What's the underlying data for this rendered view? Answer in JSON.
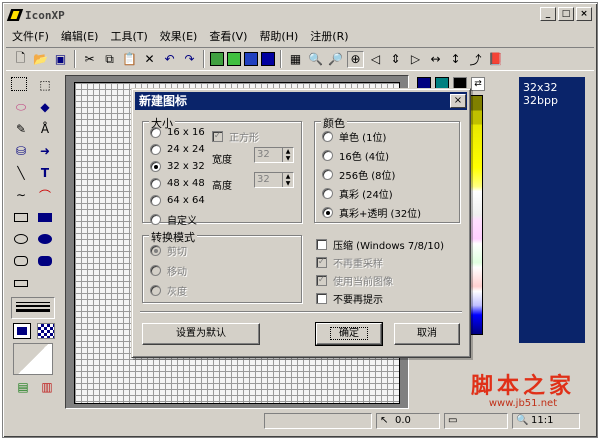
{
  "app": {
    "title": "IconXP",
    "window_buttons": [
      "_",
      "□",
      "×"
    ]
  },
  "menu": [
    "文件(F)",
    "编辑(E)",
    "工具(T)",
    "效果(E)",
    "查看(V)",
    "帮助(H)",
    "注册(R)"
  ],
  "toolbar_icons": [
    "new-icon",
    "open-icon",
    "save-icon",
    "cut-icon",
    "copy-icon",
    "paste-icon",
    "delete-icon",
    "undo-icon",
    "redo-icon",
    "color1-icon",
    "color2-icon",
    "color3-icon",
    "color4-icon",
    "grid-icon",
    "zoom-in-icon",
    "zoom-out-icon",
    "zoom-fit-icon",
    "arrow-left-icon",
    "flip-vertical-icon",
    "arrow-right-icon",
    "flip-horizontal-icon",
    "rotate-icon",
    "rotate-right-icon",
    "library-icon"
  ],
  "size_list": [
    "32x32",
    "32bpp"
  ],
  "watermark": {
    "text": "脚本之家",
    "url": "www.jb51.net"
  },
  "status": {
    "coord": "0.0",
    "zoom": "11:1"
  },
  "dialog": {
    "title": "新建图标",
    "close": "×",
    "size_group": {
      "label": "大小",
      "options": [
        "16 x 16",
        "24 x 24",
        "32 x 32",
        "48 x 48",
        "64 x 64",
        "自定义"
      ],
      "selected": 2,
      "square_label": "正方形",
      "width_label": "宽度",
      "width_value": "32",
      "height_label": "高度",
      "height_value": "32"
    },
    "color_group": {
      "label": "颜色",
      "options": [
        "单色 (1位)",
        "16色 (4位)",
        "256色 (8位)",
        "真彩 (24位)",
        "真彩+透明 (32位)"
      ],
      "selected": 4
    },
    "convert_group": {
      "label": "转换模式",
      "options": [
        "剪切",
        "移动",
        "灰度"
      ],
      "selected": 0
    },
    "checks": {
      "compress": "压缩 (Windows 7/8/10)",
      "no_resample": "不再重采样",
      "use_current": "使用当前图像",
      "dont_show": "不要再提示"
    },
    "buttons": {
      "set_default": "设置为默认",
      "ok": "确定",
      "cancel": "取消"
    }
  }
}
